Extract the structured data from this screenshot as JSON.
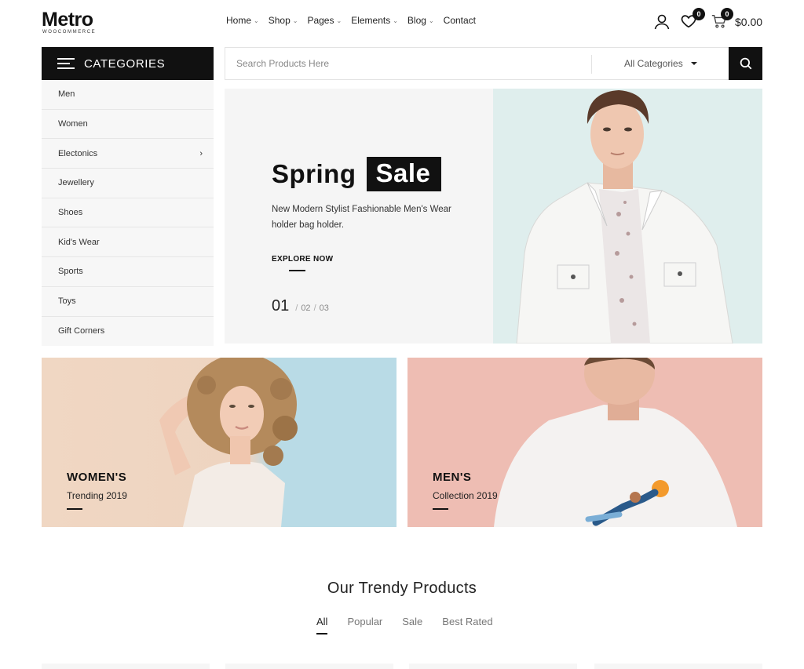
{
  "header": {
    "logo": {
      "text": "Metro",
      "sub": "WOOCOMMERCE"
    },
    "nav": [
      {
        "label": "Home",
        "dropdown": true
      },
      {
        "label": "Shop",
        "dropdown": true
      },
      {
        "label": "Pages",
        "dropdown": true
      },
      {
        "label": "Elements",
        "dropdown": true
      },
      {
        "label": "Blog",
        "dropdown": true
      },
      {
        "label": "Contact",
        "dropdown": false
      }
    ],
    "wishlist_count": "0",
    "cart_count": "0",
    "cart_total": "$0.00",
    "icons": [
      "user-icon",
      "heart-icon",
      "cart-icon"
    ]
  },
  "categories": {
    "title": "CATEGORIES",
    "items": [
      {
        "label": "Men"
      },
      {
        "label": "Women"
      },
      {
        "label": "Electonics",
        "has_sub": true
      },
      {
        "label": "Jewellery"
      },
      {
        "label": "Shoes"
      },
      {
        "label": "Kid's Wear"
      },
      {
        "label": "Sports"
      },
      {
        "label": "Toys"
      },
      {
        "label": "Gift Corners"
      }
    ]
  },
  "search": {
    "placeholder": "Search Products Here",
    "category": "All Categories"
  },
  "hero": {
    "title_a": "Spring",
    "title_b": "Sale",
    "desc": "New Modern Stylist Fashionable Men's Wear holder bag holder.",
    "cta": "EXPLORE NOW",
    "page_current": "01",
    "pages": [
      "02",
      "03"
    ],
    "sep": "/"
  },
  "banners": [
    {
      "title": "WOMEN'S",
      "sub": "Trending 2019"
    },
    {
      "title": "MEN'S",
      "sub": "Collection 2019"
    }
  ],
  "trendy": {
    "title": "Our Trendy Products",
    "tabs": [
      "All",
      "Popular",
      "Sale",
      "Best Rated"
    ],
    "active": 0
  },
  "colors": {
    "accent": "#111111",
    "hero_bg": "#f5f5f5",
    "hero_photo_bg": "#dfeeed",
    "men_banner_bg": "#eebdb3"
  }
}
